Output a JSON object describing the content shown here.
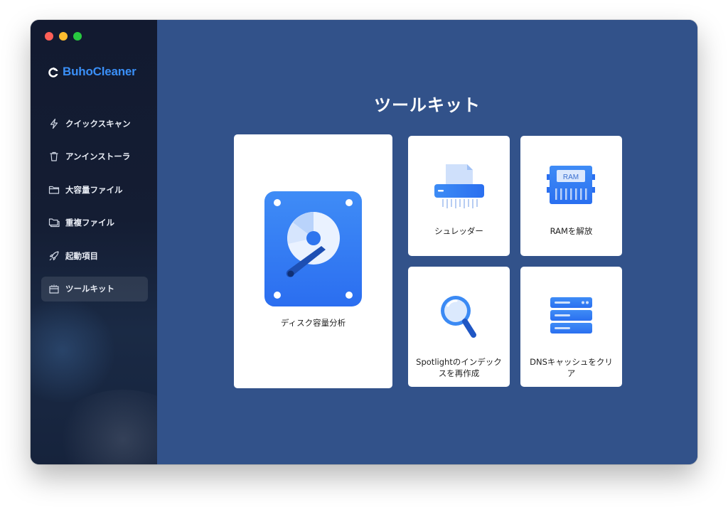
{
  "app": {
    "name": "BuhoCleaner",
    "accent_color": "#3a8ff7"
  },
  "sidebar": {
    "items": [
      {
        "label": "クイックスキャン",
        "icon": "lightning-icon"
      },
      {
        "label": "アンインストーラ",
        "icon": "trash-icon"
      },
      {
        "label": "大容量ファイル",
        "icon": "folder-icon"
      },
      {
        "label": "重複ファイル",
        "icon": "duplicate-folder-icon"
      },
      {
        "label": "起動項目",
        "icon": "rocket-icon"
      },
      {
        "label": "ツールキット",
        "icon": "toolkit-icon",
        "active": true
      }
    ]
  },
  "main": {
    "title": "ツールキット",
    "tools": [
      {
        "label": "ディスク容量分析",
        "icon": "disk-analyzer-icon"
      },
      {
        "label": "シュレッダー",
        "icon": "shredder-icon"
      },
      {
        "label": "RAMを解放",
        "icon": "ram-icon",
        "icon_text": "RAM"
      },
      {
        "label": "Spotlightのインデックスを再作成",
        "icon": "magnifier-icon"
      },
      {
        "label": "DNSキャッシュをクリア",
        "icon": "dns-server-icon"
      }
    ]
  }
}
